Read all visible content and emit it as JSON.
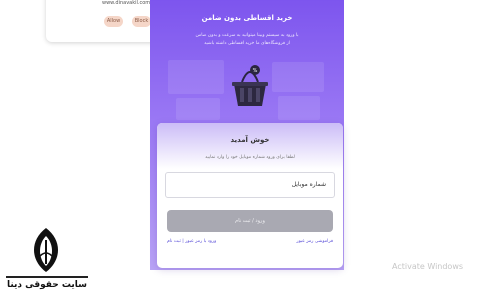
{
  "popup": {
    "text": "www.dinavakil.com",
    "button_one": "Allow",
    "button_two": "Block"
  },
  "hero": {
    "title": "خرید اقساطی بدون ضامن",
    "subtitle_line1": "با ورود به سیستم وبینا میتوانید به سرعت و بدون ضامن",
    "subtitle_line2": "از فروشگاه‌های ما خرید اقساطی داشته باشید",
    "icon": "shopping-basket-icon"
  },
  "card": {
    "title": "خوش آمدید",
    "subtitle": "لطفا برای ورود شماره موبایل خود را وارد نمایید",
    "field_value": "شماره موبایل",
    "submit_label": "ورود / ثبت نام",
    "link_left": "فراموشی رمز عبور",
    "link_right": "ورود با رمز عبور | ثبت نام"
  },
  "logo": {
    "text": "سایت حقوقی دینا"
  },
  "watermark": {
    "text": "Activate Windows"
  },
  "colors": {
    "accent": "#7d55ee",
    "submit_disabled": "#a9a9b2",
    "link": "#5a4fd8"
  }
}
